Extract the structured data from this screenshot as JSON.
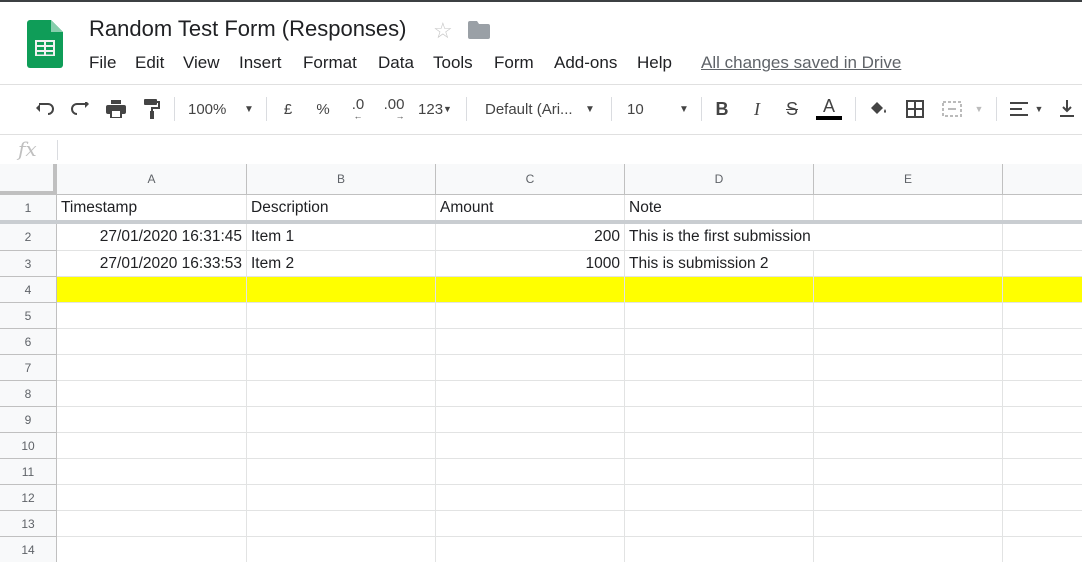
{
  "app": {
    "title": "Random Test Form (Responses)",
    "save_status": "All changes saved in Drive",
    "brand_color": "#0f9d58"
  },
  "menu": [
    "File",
    "Edit",
    "View",
    "Insert",
    "Format",
    "Data",
    "Tools",
    "Form",
    "Add-ons",
    "Help"
  ],
  "toolbar": {
    "zoom": "100%",
    "currency": "£",
    "percent": "%",
    "dec_decrease": ".0",
    "dec_increase": ".00",
    "number_format": "123",
    "font": "Default (Ari...",
    "font_size": "10",
    "bold": "B",
    "italic": "I",
    "strike": "S",
    "text_color": "A"
  },
  "formula_bar": {
    "label": "fx",
    "value": ""
  },
  "sheet": {
    "columns": [
      "A",
      "B",
      "C",
      "D",
      "E"
    ],
    "rows": [
      "1",
      "2",
      "3",
      "4",
      "5",
      "6",
      "7",
      "8",
      "9",
      "10",
      "11",
      "12",
      "13",
      "14"
    ],
    "header": [
      "Timestamp",
      "Description",
      "Amount",
      "Note",
      ""
    ],
    "data": [
      [
        "27/01/2020 16:31:45",
        "Item 1",
        "200",
        "This is the first submission",
        ""
      ],
      [
        "27/01/2020 16:33:53",
        "Item 2",
        "1000",
        "This is submission 2",
        ""
      ]
    ],
    "highlight_row": "4",
    "highlight_color": "#ffff00"
  }
}
